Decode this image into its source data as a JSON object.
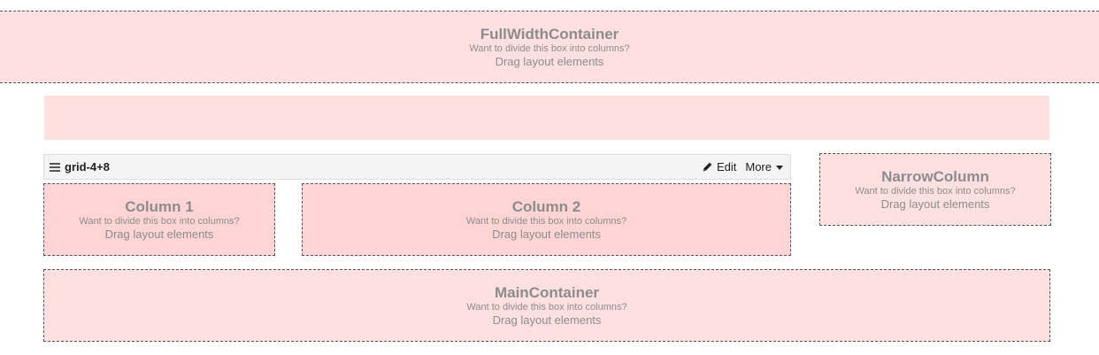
{
  "full_width": {
    "title": "FullWidthContainer",
    "hint": "Want to divide this box into columns?",
    "drag": "Drag layout elements"
  },
  "grid": {
    "name": "grid-4+8",
    "edit_label": "Edit",
    "more_label": "More",
    "handle_icon": "drag-handle-icon",
    "edit_icon": "pencil-icon",
    "more_icon": "caret-down-icon"
  },
  "column1": {
    "title": "Column 1",
    "hint": "Want to divide this box into columns?",
    "drag": "Drag layout elements"
  },
  "column2": {
    "title": "Column 2",
    "hint": "Want to divide this box into columns?",
    "drag": "Drag layout elements"
  },
  "narrow": {
    "title": "NarrowColumn",
    "hint": "Want to divide this box into columns?",
    "drag": "Drag layout elements"
  },
  "main": {
    "title": "MainContainer",
    "hint": "Want to divide this box into columns?",
    "drag": "Drag layout elements"
  },
  "colors": {
    "container_bg": "#ffe0e0",
    "column_bg": "#ffd4d4",
    "toolbar_bg": "#f4f4f5",
    "text_muted": "#8c8c8c"
  }
}
